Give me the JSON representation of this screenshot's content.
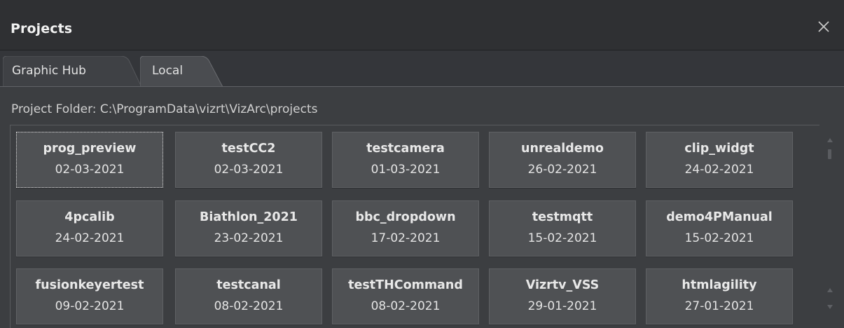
{
  "window": {
    "title": "Projects",
    "close_icon": "close-icon"
  },
  "tabs": [
    {
      "label": "Graphic Hub",
      "active": false
    },
    {
      "label": "Local",
      "active": true
    }
  ],
  "folder": {
    "label": "Project Folder: C:\\ProgramData\\vizrt\\VizArc\\projects"
  },
  "projects": [
    {
      "name": "prog_preview",
      "date": "02-03-2021",
      "focused": true
    },
    {
      "name": "testCC2",
      "date": "02-03-2021"
    },
    {
      "name": "testcamera",
      "date": "01-03-2021"
    },
    {
      "name": "unrealdemo",
      "date": "26-02-2021"
    },
    {
      "name": "clip_widgt",
      "date": "24-02-2021"
    },
    {
      "name": "4pcalib",
      "date": "24-02-2021"
    },
    {
      "name": "Biathlon_2021",
      "date": "23-02-2021"
    },
    {
      "name": "bbc_dropdown",
      "date": "17-02-2021"
    },
    {
      "name": "testmqtt",
      "date": "15-02-2021"
    },
    {
      "name": "demo4PManual",
      "date": "15-02-2021"
    },
    {
      "name": "fusionkeyertest",
      "date": "09-02-2021"
    },
    {
      "name": "testcanal",
      "date": "08-02-2021"
    },
    {
      "name": "testTHCommand",
      "date": "08-02-2021"
    },
    {
      "name": "Vizrtv_VSS",
      "date": "29-01-2021"
    },
    {
      "name": "htmlagility",
      "date": "27-01-2021"
    }
  ],
  "colors": {
    "titlebar": "#2f3033",
    "background": "#3c3e41",
    "card": "#4f5154",
    "text": "#e8e8e8"
  }
}
